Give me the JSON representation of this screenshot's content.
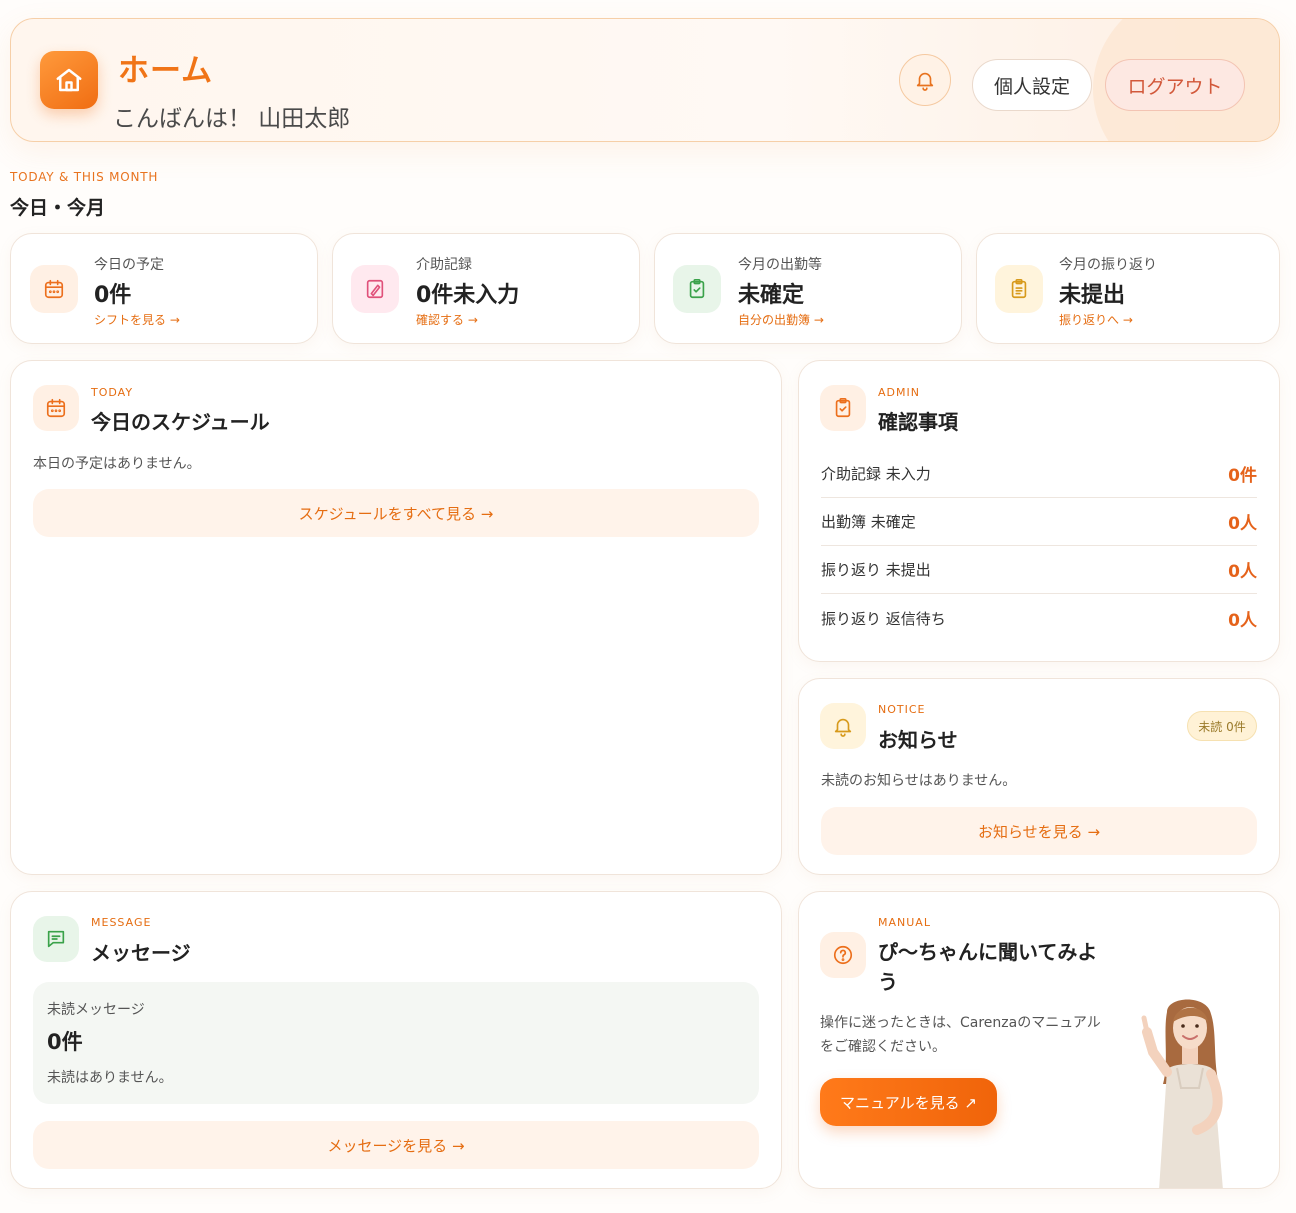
{
  "header": {
    "title": "ホーム",
    "greeting": "こんばんは！ 山田太郎",
    "settings_label": "個人設定",
    "logout_label": "ログアウト",
    "icons": [
      "home-icon",
      "bell-icon"
    ]
  },
  "section": {
    "eyebrow": "TODAY & THIS MONTH",
    "title": "今日・今月"
  },
  "stats": [
    {
      "label": "今日の予定",
      "value": "0件",
      "link": "シフトを見る →",
      "icon": "calendar-icon"
    },
    {
      "label": "介助記録",
      "value": "0件未入力",
      "link": "確認する →",
      "icon": "edit-note-icon"
    },
    {
      "label": "今月の出勤等",
      "value": "未確定",
      "link": "自分の出勤簿 →",
      "icon": "clipboard-check-icon"
    },
    {
      "label": "今月の振り返り",
      "value": "未提出",
      "link": "振り返りへ →",
      "icon": "clipboard-list-icon"
    }
  ],
  "schedule": {
    "eyebrow": "TODAY",
    "title": "今日のスケジュール",
    "empty": "本日の予定はありません。",
    "button": "スケジュールをすべて見る →"
  },
  "admin": {
    "eyebrow": "ADMIN",
    "title": "確認事項",
    "rows": [
      {
        "label": "介助記録 未入力",
        "value": "0件"
      },
      {
        "label": "出勤簿 未確定",
        "value": "0人"
      },
      {
        "label": "振り返り 未提出",
        "value": "0人"
      },
      {
        "label": "振り返り 返信待ち",
        "value": "0人"
      }
    ]
  },
  "notice": {
    "eyebrow": "NOTICE",
    "title": "お知らせ",
    "badge": "未読 0件",
    "empty": "未読のお知らせはありません。",
    "button": "お知らせを見る →"
  },
  "message": {
    "eyebrow": "MESSAGE",
    "title": "メッセージ",
    "box_label": "未読メッセージ",
    "box_value": "0件",
    "box_note": "未読はありません。",
    "button": "メッセージを見る →"
  },
  "manual": {
    "eyebrow": "MANUAL",
    "title_line1": "ぴ〜ちゃんに聞いてみよ",
    "title_line2": "う",
    "desc_line1": "操作に迷ったときは、Carenzaのマニュアル",
    "desc_line2": "をご確認ください。",
    "button": "マニュアルを見る ↗"
  },
  "colors": {
    "accent": "#f07417",
    "accent_dark": "#e56d12",
    "logout": "#d2583a",
    "green": "#3aa24a"
  }
}
